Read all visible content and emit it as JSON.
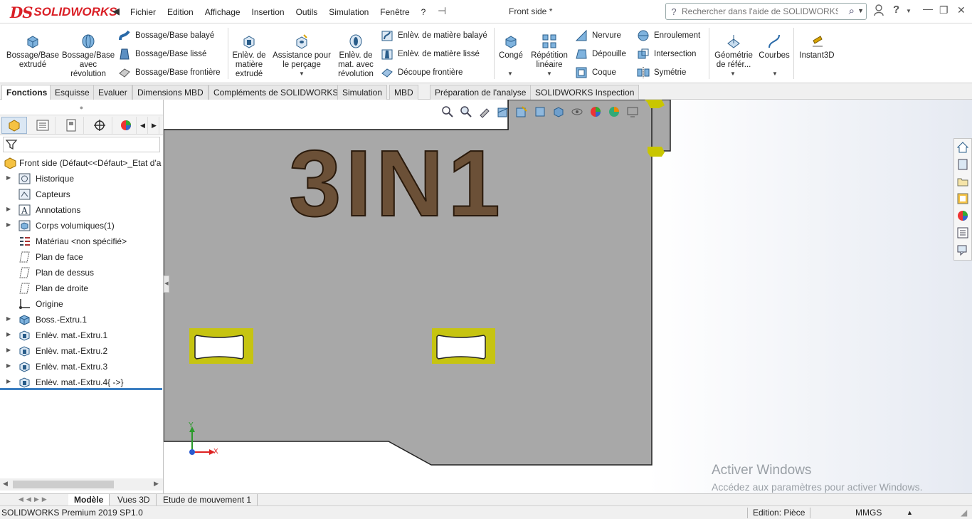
{
  "titlebar": {
    "logo_ds": "DS",
    "logo_text": "SOLIDWORKS",
    "menu": [
      "Fichier",
      "Edition",
      "Affichage",
      "Insertion",
      "Outils",
      "Simulation",
      "Fenêtre",
      "?"
    ],
    "document_title": "Front side *",
    "search_placeholder": "Rechercher dans l'aide de SOLIDWORKS",
    "icons": [
      "menu-arrow-icon",
      "pin-icon",
      "search-icon",
      "user-icon",
      "help-icon",
      "minimize-icon",
      "restore-icon",
      "close-icon"
    ]
  },
  "ribbon": {
    "boss_extrude": "Bossage/Base extrudé",
    "boss_revolve": "Bossage/Base avec révolution",
    "swept_boss": "Bossage/Base balayé",
    "lofted_boss": "Bossage/Base lissé",
    "boundary_boss": "Bossage/Base frontière",
    "extruded_cut": "Enlèv. de matière extrudé",
    "hole_wizard": "Assistance pour le perçage",
    "revolved_cut": "Enlèv. de mat. avec révolution",
    "swept_cut": "Enlèv. de matière balayé",
    "lofted_cut": "Enlèv. de matière lissé",
    "boundary_cut": "Découpe frontière",
    "fillet": "Congé",
    "linear_pattern": "Répétition linéaire",
    "rib": "Nervure",
    "draft": "Dépouille",
    "shell": "Coque",
    "wrap": "Enroulement",
    "intersect": "Intersection",
    "mirror": "Symétrie",
    "reference_geometry": "Géométrie de référ...",
    "curves": "Courbes",
    "instant3d": "Instant3D"
  },
  "command_tabs": [
    "Fonctions",
    "Esquisse",
    "Evaluer",
    "Dimensions MBD",
    "Compléments de SOLIDWORKS",
    "Simulation",
    "MBD",
    "Préparation de l'analyse",
    "SOLIDWORKS Inspection"
  ],
  "feature_tree": {
    "root": "Front side  (Défaut<<Défaut>_Etat d'a",
    "items": [
      {
        "label": "Historique",
        "icon": "history-icon",
        "expandable": true
      },
      {
        "label": "Capteurs",
        "icon": "sensors-icon",
        "expandable": false
      },
      {
        "label": "Annotations",
        "icon": "annotations-icon",
        "expandable": true
      },
      {
        "label": "Corps volumiques(1)",
        "icon": "solid-bodies-icon",
        "expandable": true
      },
      {
        "label": "Matériau <non spécifié>",
        "icon": "material-icon",
        "expandable": false
      },
      {
        "label": "Plan de face",
        "icon": "plane-icon",
        "expandable": false
      },
      {
        "label": "Plan de dessus",
        "icon": "plane-icon",
        "expandable": false
      },
      {
        "label": "Plan de droite",
        "icon": "plane-icon",
        "expandable": false
      },
      {
        "label": "Origine",
        "icon": "origin-icon",
        "expandable": false
      },
      {
        "label": "Boss.-Extru.1",
        "icon": "extrude-icon",
        "expandable": true
      },
      {
        "label": "Enlèv. mat.-Extru.1",
        "icon": "cut-extrude-icon",
        "expandable": true
      },
      {
        "label": "Enlèv. mat.-Extru.2",
        "icon": "cut-extrude-icon",
        "expandable": true
      },
      {
        "label": "Enlèv. mat.-Extru.3",
        "icon": "cut-extrude-icon",
        "expandable": true
      },
      {
        "label": "Enlèv. mat.-Extru.4{ ->}",
        "icon": "cut-extrude-icon",
        "expandable": true
      }
    ]
  },
  "model": {
    "engraved_text": "3IN1",
    "part_color": "#a8a8a8",
    "highlight_color": "#c9c600",
    "engrave_color": "#6b5037",
    "triad_y": "Y",
    "triad_x": "X"
  },
  "bottom_tabs": [
    "Modèle",
    "Vues 3D",
    "Etude de mouvement 1"
  ],
  "statusbar": {
    "product": "SOLIDWORKS Premium 2019 SP1.0",
    "edit_mode": "Edition: Pièce",
    "units": "MMGS"
  },
  "watermark": {
    "line1": "Activer Windows",
    "line2": "Accédez aux paramètres pour activer Windows."
  },
  "accent_color": "#da1f26",
  "rollback_color": "#3b7ec1"
}
